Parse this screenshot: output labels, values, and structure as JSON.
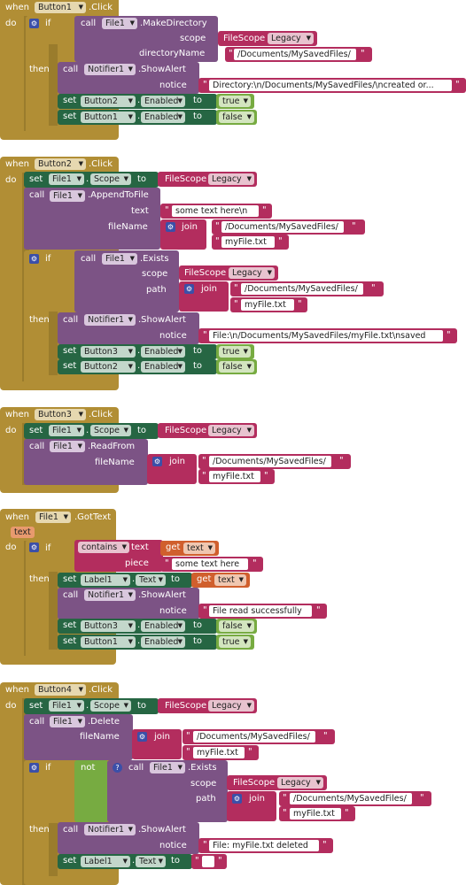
{
  "colors": {
    "event": "#b18e35",
    "event_dark": "#9a7c2c",
    "call": "#7c5385",
    "set": "#266643",
    "text": "#b32d5e",
    "logic": "#77ab41",
    "control": "#b18e35",
    "variable": "#d05f2d",
    "scope": "#b32d5e"
  },
  "kw": {
    "when": "when",
    "do": "do",
    "if": "if",
    "then": "then",
    "call": "call",
    "set": "set",
    "to": "to",
    "scope": "scope",
    "directoryName": "directoryName",
    "notice": "notice",
    "text": "text",
    "fileName": "fileName",
    "path": "path",
    "join": "join",
    "piece": "piece",
    "get": "get",
    "contains": "contains",
    "not": "not",
    "dot": "."
  },
  "e1": {
    "component": "Button1",
    "event": ".Click",
    "call_comp": "File1",
    "method": ".MakeDirectory",
    "scope_type": "FileScope",
    "scope_val": "Legacy",
    "dir": "/Documents/MySavedFiles/",
    "alert_comp": "Notifier1",
    "alert_method": ".ShowAlert",
    "notice": "Directory:\\n/Documents/MySavedFiles/\\ncreated or...",
    "s1_comp": "Button2",
    "s1_prop": "Enabled",
    "s1_val": "true",
    "s2_comp": "Button1",
    "s2_prop": "Enabled",
    "s2_val": "false"
  },
  "e2": {
    "component": "Button2",
    "event": ".Click",
    "set_comp": "File1",
    "set_prop": "Scope",
    "scope_type": "FileScope",
    "scope_val": "Legacy",
    "call_comp": "File1",
    "method": ".AppendToFile",
    "text": "some text here\\n",
    "join_a": "/Documents/MySavedFiles/",
    "join_b": "myFile.txt",
    "if_comp": "File1",
    "if_method": ".Exists",
    "if_scope_type": "FileScope",
    "if_scope_val": "Legacy",
    "if_join_a": "/Documents/MySavedFiles/",
    "if_join_b": "myFile.txt",
    "alert_comp": "Notifier1",
    "alert_method": ".ShowAlert",
    "notice": "File:\\n/Documents/MySavedFiles/myFile.txt\\nsaved",
    "s1_comp": "Button3",
    "s1_prop": "Enabled",
    "s1_val": "true",
    "s2_comp": "Button2",
    "s2_prop": "Enabled",
    "s2_val": "false"
  },
  "e3": {
    "component": "Button3",
    "event": ".Click",
    "set_comp": "File1",
    "set_prop": "Scope",
    "scope_type": "FileScope",
    "scope_val": "Legacy",
    "call_comp": "File1",
    "method": ".ReadFrom",
    "join_a": "/Documents/MySavedFiles/",
    "join_b": "myFile.txt"
  },
  "e4": {
    "component": "File1",
    "event": ".GotText",
    "param": "text",
    "get_var": "text",
    "piece": "some text here",
    "s0_comp": "Label1",
    "s0_prop": "Text",
    "alert_comp": "Notifier1",
    "alert_method": ".ShowAlert",
    "notice": "File read successfully",
    "s1_comp": "Button3",
    "s1_prop": "Enabled",
    "s1_val": "false",
    "s2_comp": "Button1",
    "s2_prop": "Enabled",
    "s2_val": "true"
  },
  "e5": {
    "component": "Button4",
    "event": ".Click",
    "set_comp": "File1",
    "set_prop": "Scope",
    "scope_type": "FileScope",
    "scope_val": "Legacy",
    "call_comp": "File1",
    "method": ".Delete",
    "join_a": "/Documents/MySavedFiles/",
    "join_b": "myFile.txt",
    "if_comp": "File1",
    "if_method": ".Exists",
    "if_scope_type": "FileScope",
    "if_scope_val": "Legacy",
    "if_join_a": "/Documents/MySavedFiles/",
    "if_join_b": "myFile.txt",
    "alert_comp": "Notifier1",
    "alert_method": ".ShowAlert",
    "notice": "File: myFile.txt deleted",
    "s0_comp": "Label1",
    "s0_prop": "Text",
    "s0_val": ""
  }
}
